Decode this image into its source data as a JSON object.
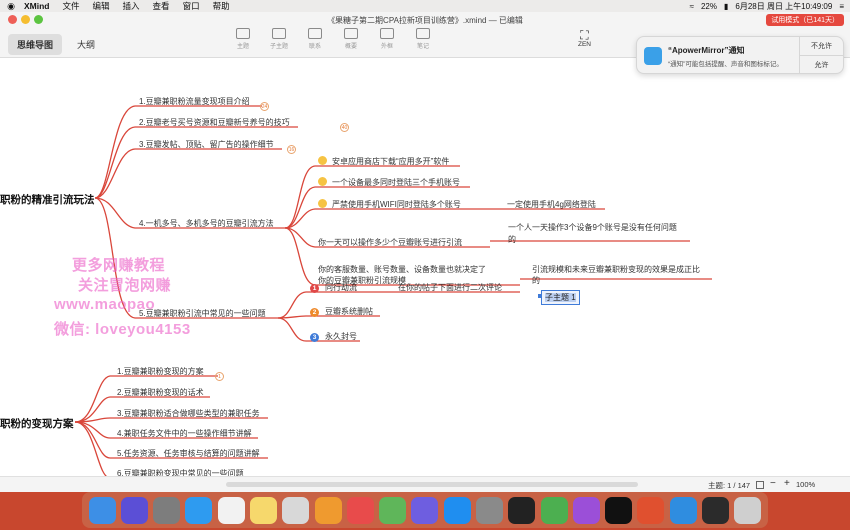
{
  "menubar": {
    "app_name": "XMind",
    "items": [
      "文件",
      "编辑",
      "插入",
      "查看",
      "窗口",
      "帮助"
    ],
    "battery": "22%",
    "datetime": "6月28日 周日 上午10:49:09"
  },
  "window": {
    "title": "《果糖子第二期CPA拉新项目训练营》.xmind — 已编辑",
    "trial_badge": "试用模式（已141天）",
    "view_tabs": [
      "思维导图",
      "大纲"
    ],
    "toolbar": [
      "主题",
      "子主题",
      "联系",
      "概要",
      "外框",
      "笔记"
    ],
    "zen_label": "ZEN"
  },
  "notification": {
    "title": "“ApowerMirror”通知",
    "body": "“通知”可能包括提醒、声音和图标标记。",
    "deny": "不允许",
    "allow": "允许"
  },
  "mindmap": {
    "main1": "职粉的精准引流玩法",
    "main1_children": [
      "1.豆瓣兼职粉流量变现项目介绍",
      "2.豆瓣老号买号资源和豆瓣新号养号的技巧",
      "3.豆瓣发帖、顶贴、留广告的操作细节",
      "4.一机多号、多机多号的豆瓣引流方法",
      "5.豆瓣兼职粉引流中常见的一些问题"
    ],
    "badges": [
      "24",
      "40",
      "16"
    ],
    "topic4_children": [
      "安卓应用商店下载“应用多开”软件",
      "一个设备最多同时登陆三个手机账号",
      "严禁使用手机WIFI同时登陆多个账号",
      "你一天可以操作多少个豆瓣账号进行引流",
      "你的客服数量、账号数量、设备数量也就决定了",
      "你的豆瓣兼职粉引流规模"
    ],
    "topic4_subs": [
      "一定使用手机4g网络登陆",
      "一个人一天操作3个设备9个账号是没有任何问题",
      "的",
      "引流规模和未来豆瓣兼职粉变现的效果是成正比",
      "的"
    ],
    "topic5_children": [
      "同行劫流",
      "豆瓣系统删帖",
      "永久封号"
    ],
    "topic5_nums": [
      "1",
      "2",
      "3"
    ],
    "topic5_sub": "在你的帖子下面进行二次评论",
    "selected_subtopic": "子主题 1",
    "main2": "职粉的变现方案",
    "main2_children": [
      "1.豆瓣兼职粉变现的方案",
      "2.豆瓣兼职粉变现的话术",
      "3.豆瓣兼职粉适合做哪些类型的兼职任务",
      "4.兼职任务文件中的一些操作细节讲解",
      "5.任务资源、任务审核与结算的问题讲解",
      "6.豆瓣兼职粉变现中常见的一些问题"
    ],
    "main2_badge": "1"
  },
  "watermark": [
    "更多网赚教程",
    "关注冒泡网赚",
    "www.maopao",
    "微信: loveyou4153"
  ],
  "statusbar": {
    "topic_count": "主题: 1 / 147",
    "zoom": "100%"
  },
  "colors": {
    "branch": "#d9463a",
    "accent": "#3f7bd8"
  }
}
